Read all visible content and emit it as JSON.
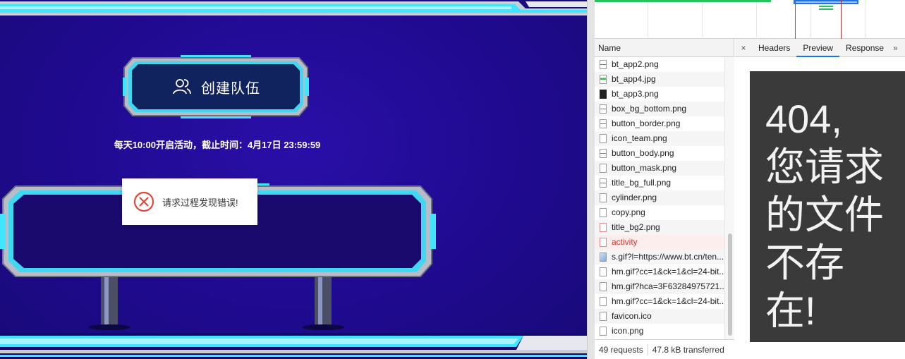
{
  "game": {
    "create_team_label": "创建队伍",
    "activity_time": "每天10:00开启活动，截止时间：4月17日 23:59:59",
    "error_toast": "请求过程发现错误!"
  },
  "devtools": {
    "name_header": "Name",
    "requests": [
      {
        "name": "bt_app2.png",
        "icon": "line"
      },
      {
        "name": "bt_app4.jpg",
        "icon": "greenish"
      },
      {
        "name": "bt_app3.png",
        "icon": "dark"
      },
      {
        "name": "box_bg_bottom.png",
        "icon": "line"
      },
      {
        "name": "button_border.png",
        "icon": "line"
      },
      {
        "name": "icon_team.png",
        "icon": "plain"
      },
      {
        "name": "button_body.png",
        "icon": "line"
      },
      {
        "name": "button_mask.png",
        "icon": "plain"
      },
      {
        "name": "title_bg_full.png",
        "icon": "line"
      },
      {
        "name": "cylinder.png",
        "icon": "plain"
      },
      {
        "name": "copy.png",
        "icon": "plain"
      },
      {
        "name": "title_bg2.png",
        "icon": "err"
      },
      {
        "name": "activity",
        "icon": "err",
        "error": true
      },
      {
        "name": "s.gif?l=https://www.bt.cn/ten...",
        "icon": "img"
      },
      {
        "name": "hm.gif?cc=1&ck=1&cl=24-bit...",
        "icon": "plain"
      },
      {
        "name": "hm.gif?hca=3F63284975721...",
        "icon": "plain"
      },
      {
        "name": "hm.gif?cc=1&ck=1&cl=24-bit...",
        "icon": "plain"
      },
      {
        "name": "favicon.ico",
        "icon": "plain"
      },
      {
        "name": "icon.png",
        "icon": "plain"
      }
    ],
    "request_count": "49 requests",
    "transferred": "47.8 kB transferred",
    "close_label": "×",
    "tabs": [
      {
        "label": "Headers",
        "active": false
      },
      {
        "label": "Preview",
        "active": true
      },
      {
        "label": "Response",
        "active": false
      }
    ],
    "more_label": "»",
    "preview_text": "404, 您请求的文件不存在!"
  }
}
